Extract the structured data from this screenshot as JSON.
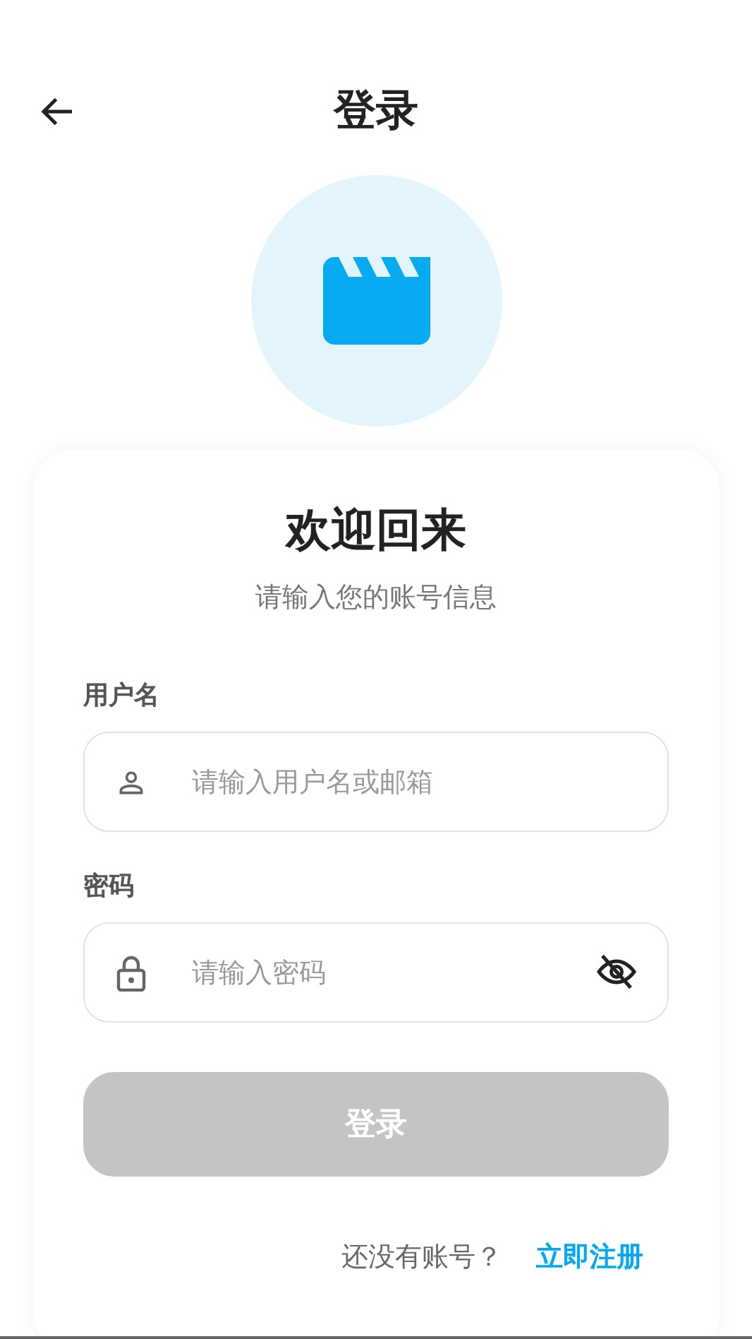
{
  "header": {
    "title": "登录"
  },
  "welcome": {
    "title": "欢迎回来",
    "subtitle": "请输入您的账号信息"
  },
  "fields": [
    {
      "kind": "username",
      "label": "用户名",
      "placeholder": "请输入用户名或邮箱"
    },
    {
      "kind": "password",
      "label": "密码",
      "placeholder": "请输入密码",
      "visible": false
    }
  ],
  "login_button": {
    "label": "登录",
    "disabled": true
  },
  "footer": {
    "prompt": "还没有账号？",
    "link": "立即注册"
  }
}
